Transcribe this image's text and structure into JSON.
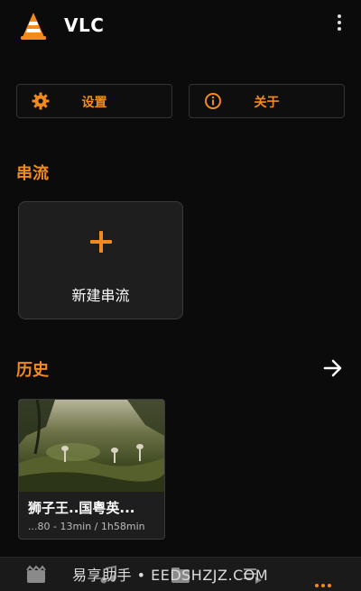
{
  "appbar": {
    "title": "VLC",
    "logo_icon": "vlc-cone-icon",
    "menu_icon": "more-vertical-icon"
  },
  "actions": {
    "settings": {
      "label": "设置",
      "icon": "gear-icon"
    },
    "about": {
      "label": "关于",
      "icon": "info-icon"
    }
  },
  "stream": {
    "section_title": "串流",
    "new_stream_label": "新建串流",
    "new_stream_icon": "plus-icon"
  },
  "history": {
    "section_title": "历史",
    "more_icon": "arrow-right-icon",
    "items": [
      {
        "title": "狮子王..国粤英...",
        "meta": "...80 - 13min / 1h58min"
      }
    ]
  },
  "bottom_nav": {
    "items": [
      "video-icon",
      "audio-icon",
      "browse-icon",
      "playlist-icon",
      "more-icon"
    ],
    "watermark": "易享助手 • EEDSHZJZ.COM"
  },
  "colors": {
    "accent": "#f28b1c",
    "background": "#0b0b0b",
    "card": "#1e1e1e"
  }
}
